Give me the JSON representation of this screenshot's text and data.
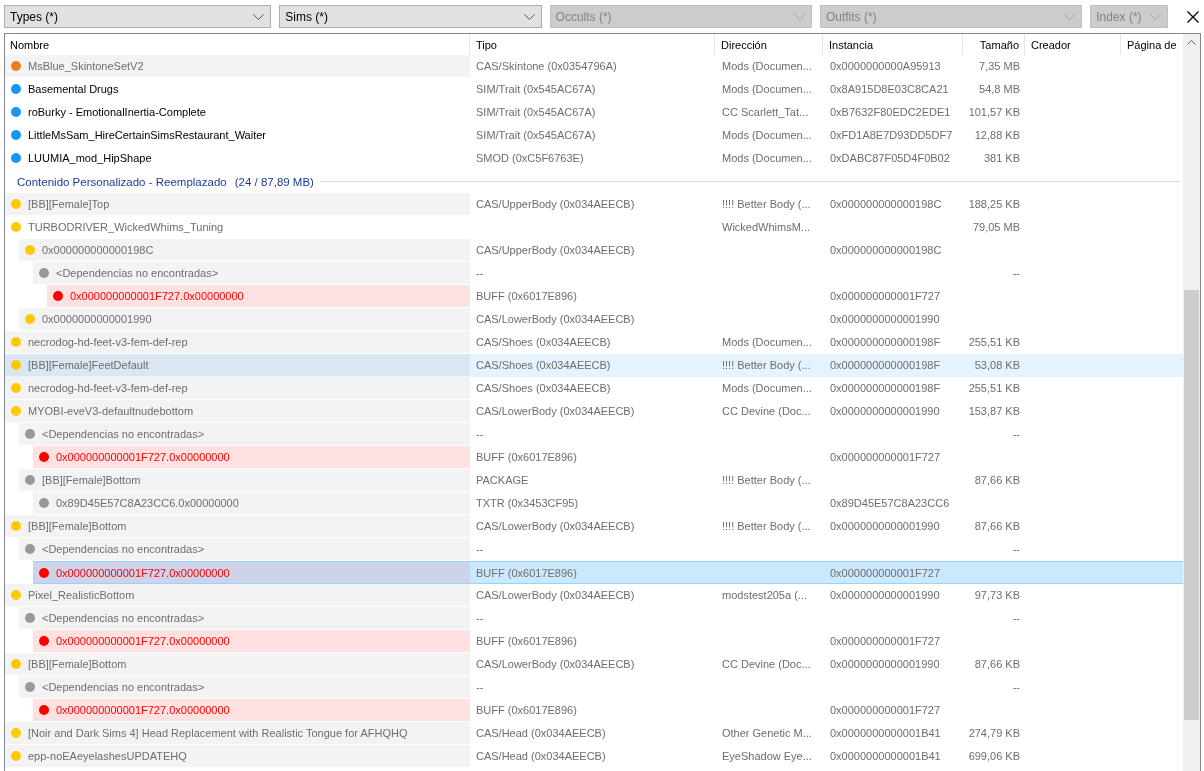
{
  "filters": [
    {
      "label": "Types (*)",
      "disabled": false
    },
    {
      "label": "Sims (*)",
      "disabled": false
    },
    {
      "label": "Occults (*)",
      "disabled": true
    },
    {
      "label": "Outfits (*)",
      "disabled": true
    },
    {
      "label": "Index (*)",
      "disabled": true
    }
  ],
  "table": {
    "columns": [
      "Nombre",
      "Tipo",
      "Dirección",
      "Instancia",
      "Tamaño",
      "Creador",
      "Página de"
    ],
    "groups": [
      {
        "rows": [
          {
            "name": "MsBlue_SkintoneSetV2",
            "type": "CAS/Skintone (0x0354796A)",
            "directory": "Mods (Documen...",
            "instance": "0x0000000000A95913",
            "size": "7,35 MB",
            "color": "#f47c20",
            "kind": "shaded",
            "selected": false,
            "hovered": false
          },
          {
            "name": "Basemental Drugs",
            "type": "SIM/Trait (0x545AC67A)",
            "directory": "Mods (Documen...",
            "instance": "0x8A915D8E03C8CA21",
            "size": "54,8 MB",
            "color": "#1597f7",
            "kind": "plain",
            "selected": false,
            "hovered": false
          },
          {
            "name": "roBurky - EmotionalInertia-Complete",
            "type": "SIM/Trait (0x545AC67A)",
            "directory": "CC Scarlett_Tat...",
            "instance": "0xB7632F80EDC2EDE1",
            "size": "101,57 KB",
            "color": "#1597f7",
            "kind": "plain",
            "selected": false,
            "hovered": false
          },
          {
            "name": "LittleMsSam_HireCertainSimsRestaurant_Waiter",
            "type": "SIM/Trait (0x545AC67A)",
            "directory": "Mods (Documen...",
            "instance": "0xFD1A8E7D93DD5DF7",
            "size": "12,88 KB",
            "color": "#1597f7",
            "kind": "plain",
            "selected": false,
            "hovered": false
          },
          {
            "name": "LUUMIA_mod_HipShape",
            "type": "SMOD (0xC5F6763E)",
            "directory": "Mods (Documen...",
            "instance": "0xDABC87F05D4F0B02",
            "size": "381 KB",
            "color": "#1597f7",
            "kind": "plain",
            "selected": false,
            "hovered": false
          }
        ]
      },
      {
        "title": "Contenido Personalizado - Reemplazado",
        "count": "(24 / 87,89 MB)",
        "rows": [
          {
            "name": "[BB][Female]Top",
            "type": "CAS/UpperBody (0x034AEECB)",
            "directory": "!!!! Better Body (...",
            "instance": "0x000000000000198C",
            "size": "188,25 KB",
            "color": "#ffc807",
            "kind": "shaded",
            "selected": false,
            "hovered": false
          },
          {
            "name": "TURBODRIVER_WickedWhims_Tuning",
            "directory": "WickedWhimsM...",
            "size": "79,05 MB",
            "color": "#ffc807",
            "kind": "folder",
            "selected": false,
            "hovered": false,
            "children": [
              {
                "name": "0x000000000000198C",
                "type": "CAS/UpperBody (0x034AEECB)",
                "instance": "0x000000000000198C",
                "color": "#ffc807",
                "kind": "shaded",
                "selected": false,
                "hovered": false,
                "children": [
                  {
                    "name": "<Dependencias no encontradas>",
                    "type": "--",
                    "size": "--",
                    "color": "#999999",
                    "kind": "shaded",
                    "selected": false,
                    "hovered": false,
                    "children": [
                      {
                        "name": "0x000000000001F727.0x00000000",
                        "type": "BUFF (0x6017E896)",
                        "instance": "0x000000000001F727",
                        "color": "#ff0000",
                        "kind": "missing",
                        "selected": false,
                        "hovered": false
                      }
                    ]
                  }
                ]
              },
              {
                "name": "0x0000000000001990",
                "type": "CAS/LowerBody (0x034AEECB)",
                "instance": "0x0000000000001990",
                "color": "#ffc807",
                "kind": "shaded",
                "selected": false,
                "hovered": false
              }
            ]
          },
          {
            "name": "necrodog-hd-feet-v3-fem-def-rep",
            "type": "CAS/Shoes (0x034AEECB)",
            "directory": "Mods (Documen...",
            "instance": "0x000000000000198F",
            "size": "255,51 KB",
            "color": "#ffc807",
            "kind": "shaded",
            "selected": false,
            "hovered": false
          },
          {
            "name": "[BB][Female]FeetDefault",
            "type": "CAS/Shoes (0x034AEECB)",
            "directory": "!!!! Better Body (...",
            "instance": "0x000000000000198F",
            "size": "53,08 KB",
            "color": "#ffc807",
            "kind": "shaded",
            "selected": false,
            "hovered": true
          },
          {
            "name": "necrodog-hd-feet-v3-fem-def-rep",
            "type": "CAS/Shoes (0x034AEECB)",
            "directory": "Mods (Documen...",
            "instance": "0x000000000000198F",
            "size": "255,51 KB",
            "color": "#ffc807",
            "kind": "shaded",
            "selected": false,
            "hovered": false
          },
          {
            "name": "MYOBI-eveV3-defaultnudebottom",
            "type": "CAS/LowerBody (0x034AEECB)",
            "directory": "CC Devine (Doc...",
            "instance": "0x0000000000001990",
            "size": "153,87 KB",
            "color": "#ffc807",
            "kind": "shaded",
            "selected": false,
            "hovered": false,
            "children": [
              {
                "name": "<Dependencias no encontradas>",
                "type": "--",
                "size": "--",
                "color": "#999999",
                "kind": "shaded",
                "selected": false,
                "hovered": false,
                "children": [
                  {
                    "name": "0x000000000001F727.0x00000000",
                    "type": "BUFF (0x6017E896)",
                    "instance": "0x000000000001F727",
                    "color": "#ff0000",
                    "kind": "missing",
                    "selected": false,
                    "hovered": false
                  }
                ]
              },
              {
                "name": "[BB][Female]Bottom",
                "type": "PACKAGE",
                "directory": "!!!! Better Body (...",
                "size": "87,66 KB",
                "color": "#999999",
                "kind": "shaded",
                "selected": false,
                "hovered": false,
                "children": [
                  {
                    "name": "0x89D45E57C8A23CC6.0x00000000",
                    "type": "TXTR (0x3453CF95)",
                    "instance": "0x89D45E57C8A23CC6",
                    "color": "#999999",
                    "kind": "shaded",
                    "selected": false,
                    "hovered": false
                  }
                ]
              }
            ]
          },
          {
            "name": "[BB][Female]Bottom",
            "type": "CAS/LowerBody (0x034AEECB)",
            "directory": "!!!! Better Body (...",
            "instance": "0x0000000000001990",
            "size": "87,66 KB",
            "color": "#ffc807",
            "kind": "shaded",
            "selected": false,
            "hovered": false,
            "children": [
              {
                "name": "<Dependencias no encontradas>",
                "type": "--",
                "size": "--",
                "color": "#999999",
                "kind": "shaded",
                "selected": false,
                "hovered": false,
                "children": [
                  {
                    "name": "0x000000000001F727.0x00000000",
                    "type": "BUFF (0x6017E896)",
                    "instance": "0x000000000001F727",
                    "color": "#ff0000",
                    "kind": "missing",
                    "selected": true,
                    "hovered": false
                  }
                ]
              }
            ]
          },
          {
            "name": "Pixel_RealisticBottom",
            "type": "CAS/LowerBody (0x034AEECB)",
            "directory": "modstest205a (...",
            "instance": "0x0000000000001990",
            "size": "97,73 KB",
            "color": "#ffc807",
            "kind": "shaded",
            "selected": false,
            "hovered": false,
            "children": [
              {
                "name": "<Dependencias no encontradas>",
                "type": "--",
                "size": "--",
                "color": "#999999",
                "kind": "shaded",
                "selected": false,
                "hovered": false,
                "children": [
                  {
                    "name": "0x000000000001F727.0x00000000",
                    "type": "BUFF (0x6017E896)",
                    "instance": "0x000000000001F727",
                    "color": "#ff0000",
                    "kind": "missing",
                    "selected": false,
                    "hovered": false
                  }
                ]
              }
            ]
          },
          {
            "name": "[BB][Female]Bottom",
            "type": "CAS/LowerBody (0x034AEECB)",
            "directory": "CC Devine (Doc...",
            "instance": "0x0000000000001990",
            "size": "87,66 KB",
            "color": "#ffc807",
            "kind": "shaded",
            "selected": false,
            "hovered": false,
            "children": [
              {
                "name": "<Dependencias no encontradas>",
                "type": "--",
                "size": "--",
                "color": "#999999",
                "kind": "shaded",
                "selected": false,
                "hovered": false,
                "children": [
                  {
                    "name": "0x000000000001F727.0x00000000",
                    "type": "BUFF (0x6017E896)",
                    "instance": "0x000000000001F727",
                    "color": "#ff0000",
                    "kind": "missing",
                    "selected": false,
                    "hovered": false
                  }
                ]
              }
            ]
          },
          {
            "name": "[Noir and Dark Sims 4] Head Replacement with Realistic Tongue for AFHQHQ",
            "type": "CAS/Head (0x034AEECB)",
            "directory": "Other Genetic M...",
            "instance": "0x0000000000001B41",
            "size": "274,79 KB",
            "color": "#ffc807",
            "kind": "shaded",
            "selected": false,
            "hovered": false
          },
          {
            "name": "epp-noEAeyelashesUPDATEHQ",
            "type": "CAS/Head (0x034AEECB)",
            "directory": "EyeShadow Eye...",
            "instance": "0x0000000000001B41",
            "size": "699,06 KB",
            "color": "#ffc807",
            "kind": "shaded",
            "selected": false,
            "hovered": false
          }
        ]
      }
    ]
  }
}
